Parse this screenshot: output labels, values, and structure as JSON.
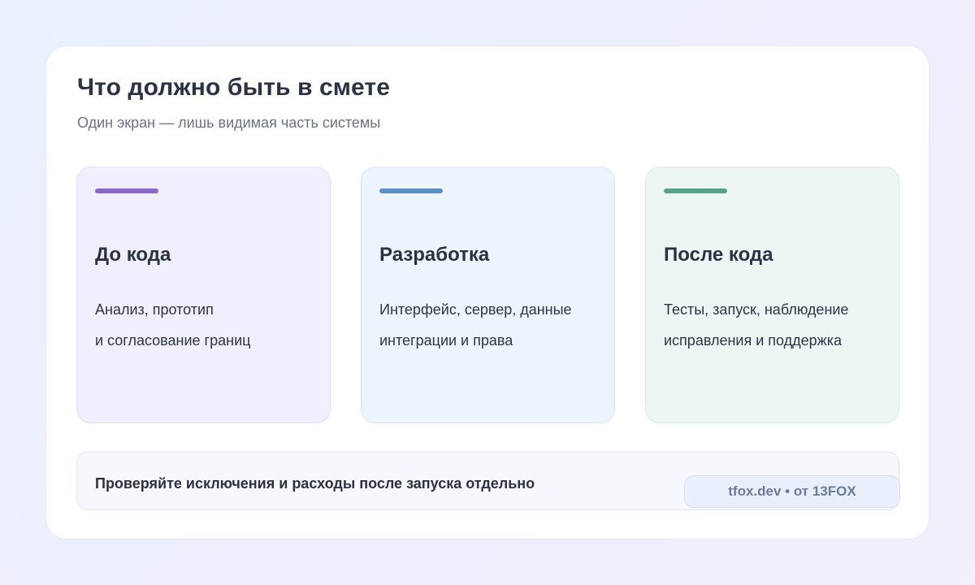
{
  "header": {
    "title": "Что должно быть в смете",
    "subtitle": "Один экран — лишь видимая часть системы"
  },
  "columns": [
    {
      "title": "До кода",
      "line1": "Анализ, прототип",
      "line2": "и согласование границ",
      "accent_color": "#8a67cc",
      "background": "#f1effd"
    },
    {
      "title": "Разработка",
      "line1": "Интерфейс, сервер, данные",
      "line2": "интеграции и права",
      "accent_color": "#5b8fcc",
      "background": "#ecf4fe"
    },
    {
      "title": "После кода",
      "line1": "Тесты, запуск, наблюдение",
      "line2": "исправления и поддержка",
      "accent_color": "#55a38a",
      "background": "#edf6f2"
    }
  ],
  "footer": {
    "note": "Проверяйте исключения и расходы после запуска отдельно",
    "badge": "tfox.dev • от 13FOX"
  }
}
